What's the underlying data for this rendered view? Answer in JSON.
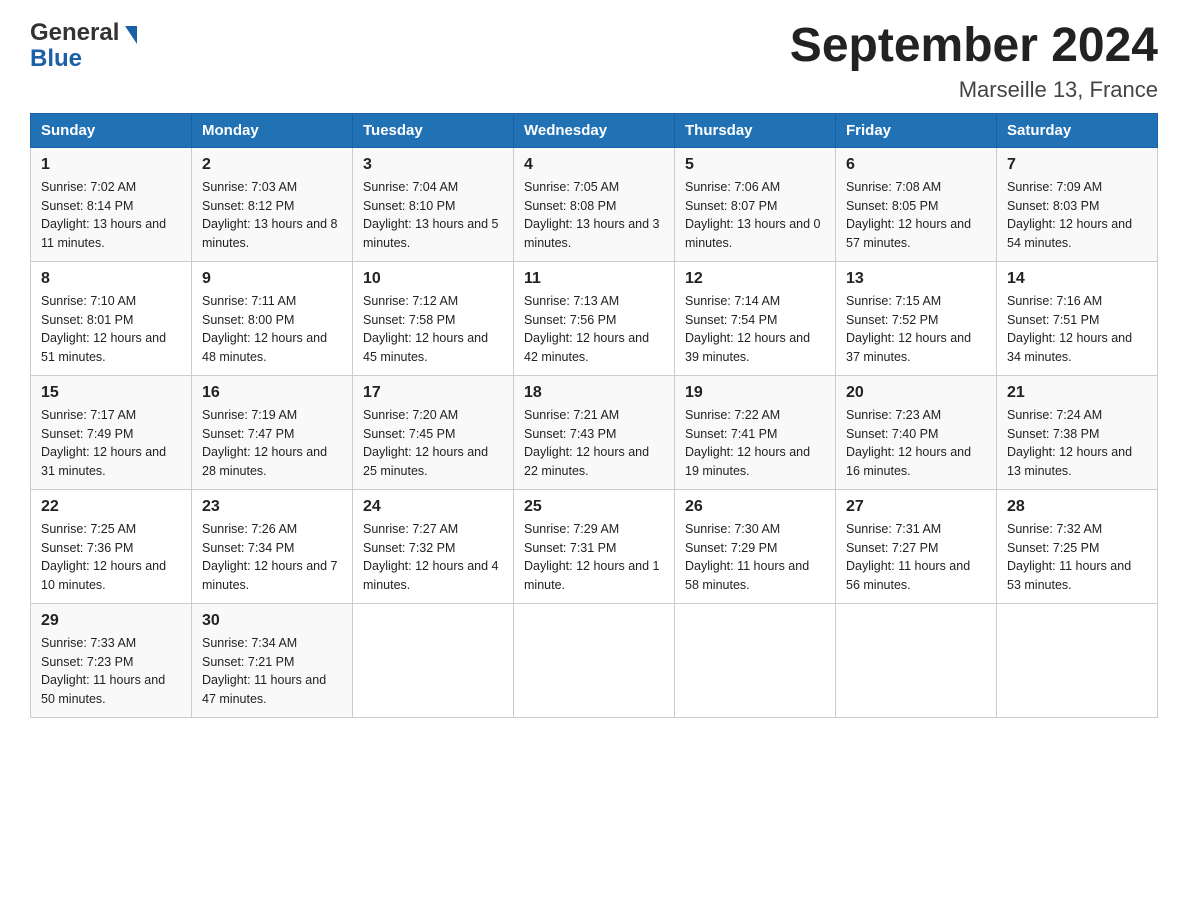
{
  "header": {
    "logo_general": "General",
    "logo_blue": "Blue",
    "month_year": "September 2024",
    "location": "Marseille 13, France"
  },
  "days_of_week": [
    "Sunday",
    "Monday",
    "Tuesday",
    "Wednesday",
    "Thursday",
    "Friday",
    "Saturday"
  ],
  "weeks": [
    [
      {
        "num": "1",
        "sunrise": "7:02 AM",
        "sunset": "8:14 PM",
        "daylight": "13 hours and 11 minutes."
      },
      {
        "num": "2",
        "sunrise": "7:03 AM",
        "sunset": "8:12 PM",
        "daylight": "13 hours and 8 minutes."
      },
      {
        "num": "3",
        "sunrise": "7:04 AM",
        "sunset": "8:10 PM",
        "daylight": "13 hours and 5 minutes."
      },
      {
        "num": "4",
        "sunrise": "7:05 AM",
        "sunset": "8:08 PM",
        "daylight": "13 hours and 3 minutes."
      },
      {
        "num": "5",
        "sunrise": "7:06 AM",
        "sunset": "8:07 PM",
        "daylight": "13 hours and 0 minutes."
      },
      {
        "num": "6",
        "sunrise": "7:08 AM",
        "sunset": "8:05 PM",
        "daylight": "12 hours and 57 minutes."
      },
      {
        "num": "7",
        "sunrise": "7:09 AM",
        "sunset": "8:03 PM",
        "daylight": "12 hours and 54 minutes."
      }
    ],
    [
      {
        "num": "8",
        "sunrise": "7:10 AM",
        "sunset": "8:01 PM",
        "daylight": "12 hours and 51 minutes."
      },
      {
        "num": "9",
        "sunrise": "7:11 AM",
        "sunset": "8:00 PM",
        "daylight": "12 hours and 48 minutes."
      },
      {
        "num": "10",
        "sunrise": "7:12 AM",
        "sunset": "7:58 PM",
        "daylight": "12 hours and 45 minutes."
      },
      {
        "num": "11",
        "sunrise": "7:13 AM",
        "sunset": "7:56 PM",
        "daylight": "12 hours and 42 minutes."
      },
      {
        "num": "12",
        "sunrise": "7:14 AM",
        "sunset": "7:54 PM",
        "daylight": "12 hours and 39 minutes."
      },
      {
        "num": "13",
        "sunrise": "7:15 AM",
        "sunset": "7:52 PM",
        "daylight": "12 hours and 37 minutes."
      },
      {
        "num": "14",
        "sunrise": "7:16 AM",
        "sunset": "7:51 PM",
        "daylight": "12 hours and 34 minutes."
      }
    ],
    [
      {
        "num": "15",
        "sunrise": "7:17 AM",
        "sunset": "7:49 PM",
        "daylight": "12 hours and 31 minutes."
      },
      {
        "num": "16",
        "sunrise": "7:19 AM",
        "sunset": "7:47 PM",
        "daylight": "12 hours and 28 minutes."
      },
      {
        "num": "17",
        "sunrise": "7:20 AM",
        "sunset": "7:45 PM",
        "daylight": "12 hours and 25 minutes."
      },
      {
        "num": "18",
        "sunrise": "7:21 AM",
        "sunset": "7:43 PM",
        "daylight": "12 hours and 22 minutes."
      },
      {
        "num": "19",
        "sunrise": "7:22 AM",
        "sunset": "7:41 PM",
        "daylight": "12 hours and 19 minutes."
      },
      {
        "num": "20",
        "sunrise": "7:23 AM",
        "sunset": "7:40 PM",
        "daylight": "12 hours and 16 minutes."
      },
      {
        "num": "21",
        "sunrise": "7:24 AM",
        "sunset": "7:38 PM",
        "daylight": "12 hours and 13 minutes."
      }
    ],
    [
      {
        "num": "22",
        "sunrise": "7:25 AM",
        "sunset": "7:36 PM",
        "daylight": "12 hours and 10 minutes."
      },
      {
        "num": "23",
        "sunrise": "7:26 AM",
        "sunset": "7:34 PM",
        "daylight": "12 hours and 7 minutes."
      },
      {
        "num": "24",
        "sunrise": "7:27 AM",
        "sunset": "7:32 PM",
        "daylight": "12 hours and 4 minutes."
      },
      {
        "num": "25",
        "sunrise": "7:29 AM",
        "sunset": "7:31 PM",
        "daylight": "12 hours and 1 minute."
      },
      {
        "num": "26",
        "sunrise": "7:30 AM",
        "sunset": "7:29 PM",
        "daylight": "11 hours and 58 minutes."
      },
      {
        "num": "27",
        "sunrise": "7:31 AM",
        "sunset": "7:27 PM",
        "daylight": "11 hours and 56 minutes."
      },
      {
        "num": "28",
        "sunrise": "7:32 AM",
        "sunset": "7:25 PM",
        "daylight": "11 hours and 53 minutes."
      }
    ],
    [
      {
        "num": "29",
        "sunrise": "7:33 AM",
        "sunset": "7:23 PM",
        "daylight": "11 hours and 50 minutes."
      },
      {
        "num": "30",
        "sunrise": "7:34 AM",
        "sunset": "7:21 PM",
        "daylight": "11 hours and 47 minutes."
      },
      null,
      null,
      null,
      null,
      null
    ]
  ],
  "labels": {
    "sunrise": "Sunrise:",
    "sunset": "Sunset:",
    "daylight": "Daylight:"
  }
}
